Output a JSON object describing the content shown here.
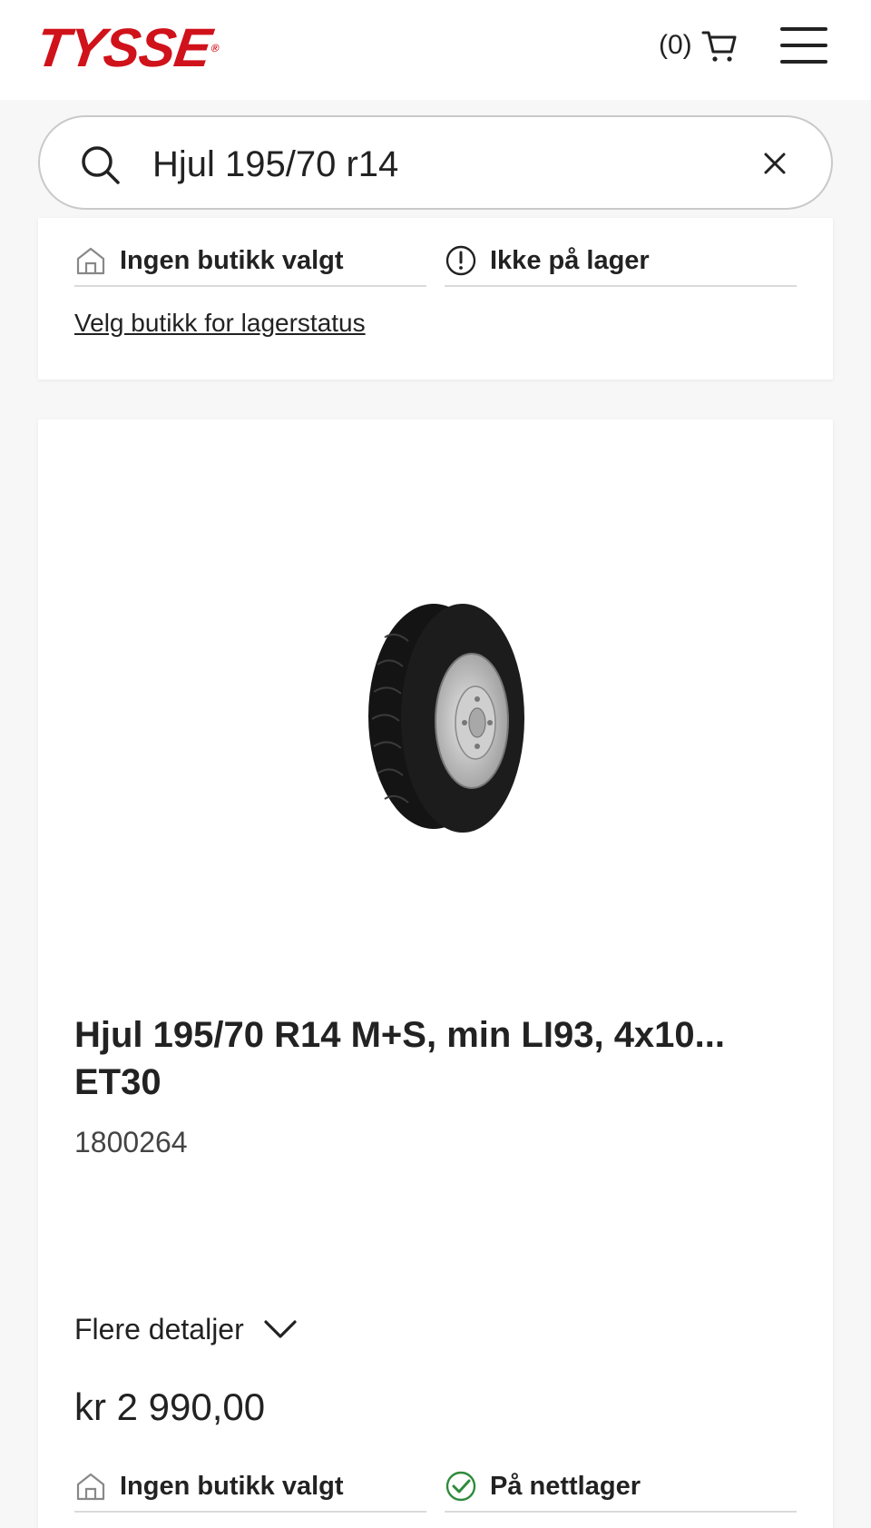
{
  "header": {
    "logo_text": "TYSSE",
    "logo_mark": "®",
    "cart_count": "(0)",
    "cart_icon": "cart-icon",
    "menu_icon": "hamburger-icon",
    "brand_color": "#d0121b"
  },
  "search": {
    "value": "Hjul 195/70 r14",
    "icon": "search-icon",
    "clear_icon": "close-icon"
  },
  "top_card": {
    "store_status": "Ingen butikk valgt",
    "stock_status": "Ikke på lager",
    "stock_icon": "alert-circle-icon",
    "store_link": "Velg butikk for lagerstatus"
  },
  "product": {
    "title": "Hjul 195/70 R14 M+S, min LI93, 4x10... ET30",
    "sku": "1800264",
    "details_label": "Flere detaljer",
    "price": "kr 2 990,00",
    "store_status": "Ingen butikk valgt",
    "online_status": "På nettlager",
    "online_status_color": "#2e8b3a"
  }
}
